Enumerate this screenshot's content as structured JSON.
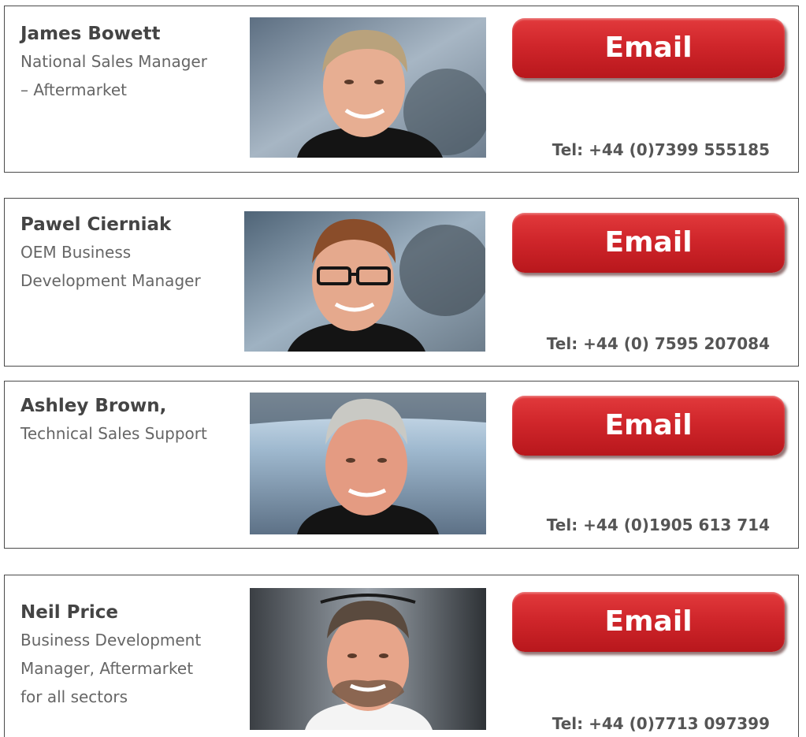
{
  "contacts": [
    {
      "name": "James Bowett",
      "role_lines": [
        "National Sales Manager",
        "– Aftermarket"
      ],
      "email_label": "Email",
      "tel": "Tel: +44 (0)7399 555185"
    },
    {
      "name": "Pawel Cierniak",
      "role_lines": [
        "OEM Business",
        "Development Manager"
      ],
      "email_label": "Email",
      "tel": "Tel: +44 (0) 7595 207084"
    },
    {
      "name": "Ashley Brown,",
      "role_lines": [
        "Technical Sales Support"
      ],
      "email_label": "Email",
      "tel": "Tel: +44 (0)1905 613 714"
    },
    {
      "name": "Neil Price",
      "role_lines": [
        "Business Development",
        "Manager, Aftermarket",
        "for all sectors"
      ],
      "email_label": "Email",
      "tel": "Tel: +44 (0)7713 097399"
    }
  ],
  "colors": {
    "email_button": "#d0262b",
    "name_text": "#444444",
    "role_text": "#666666",
    "tel_text": "#555555",
    "card_border": "#4a4a4a"
  }
}
